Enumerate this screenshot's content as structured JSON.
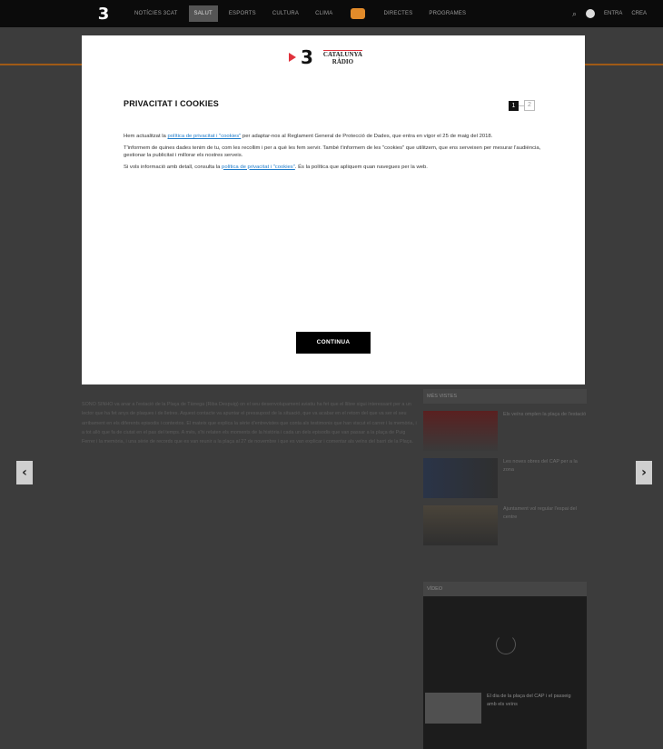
{
  "nav": {
    "logo": "3",
    "items": [
      "NOTÍCIES 3CAT",
      "SALUT",
      "ESPORTS",
      "CULTURA",
      "CLIMA"
    ],
    "right_items": [
      "DIRECTES",
      "PROGRAMES"
    ],
    "search": "⌕",
    "login": "ENTRA",
    "signup": "CREA"
  },
  "modal": {
    "logo_3": "3",
    "radio_line1": "CATALUNYA",
    "radio_line2": "RÀDIO",
    "title": "PRIVACITAT I COOKIES",
    "page_active": "1",
    "page_other": "2",
    "p1_before": "Hem actualitzat la ",
    "p1_link": "política de privacitat i \"cookies\"",
    "p1_after": " per adaptar-nos al Reglament General de Protecció de Dades, que entra en vigor el 25 de maig del 2018.",
    "p2": "T'informem de quines dades tenim de tu, com les recollim i per a què les fem servir. També t'informem de les \"cookies\" que utilitzem, que ens serveixen per mesurar l'audiència, gestionar la publicitat i millorar els nostres serveis.",
    "p3_before": "Si vols informació amb detall, consulta la ",
    "p3_link": "política de privacitat i \"cookies\"",
    "p3_after": ". És la política que apliquem quan navegues per la web.",
    "continue": "CONTINUA"
  },
  "background": {
    "article": "SONO SINHO va anar a l'estació de la Plaça de Tàrrega (Riba Despuig) on el seu desenvolupament aviatiu ha fet que el llibre sigui interessant per a un lector que ha fet anys de plaques i de lletres. Aquest contacte va apuntar el pressupost de la situació, que va acabar en el retorn del que va ser el seu arribament en els diferents episodis i contextos. El mateix que explica la sèrie d'entrevistes que conta als testimonis que han viscut el carrer i la memòria, i a tot allò que fa de ciutat en el pas del temps. A més, s'hi relaten els moments de la història i cada un dels episodis que van passar a la plaça de Puig Ferrer i la memòria, i una sèrie de records que es van reunir a la plaça al 27 de novembre i que es van explicar i comentar als veïns del barri de la Plaça.",
    "side_title": "MÉS VISTES",
    "side_items": [
      "Els veïns omplen la plaça de l'estació",
      "Les noves obres del CAP per a la zona",
      "Ajuntament vol regular l'espai del centre"
    ],
    "video_title": "VÍDEO",
    "video_caption": "El dia de la plaça del CAP i el passeig amb els veïns"
  },
  "arrows": {
    "left": "‹",
    "right": "›"
  },
  "colors": {
    "accent": "#e0323c",
    "link": "#1e7bc9",
    "overlay": "#3c3c3c"
  }
}
